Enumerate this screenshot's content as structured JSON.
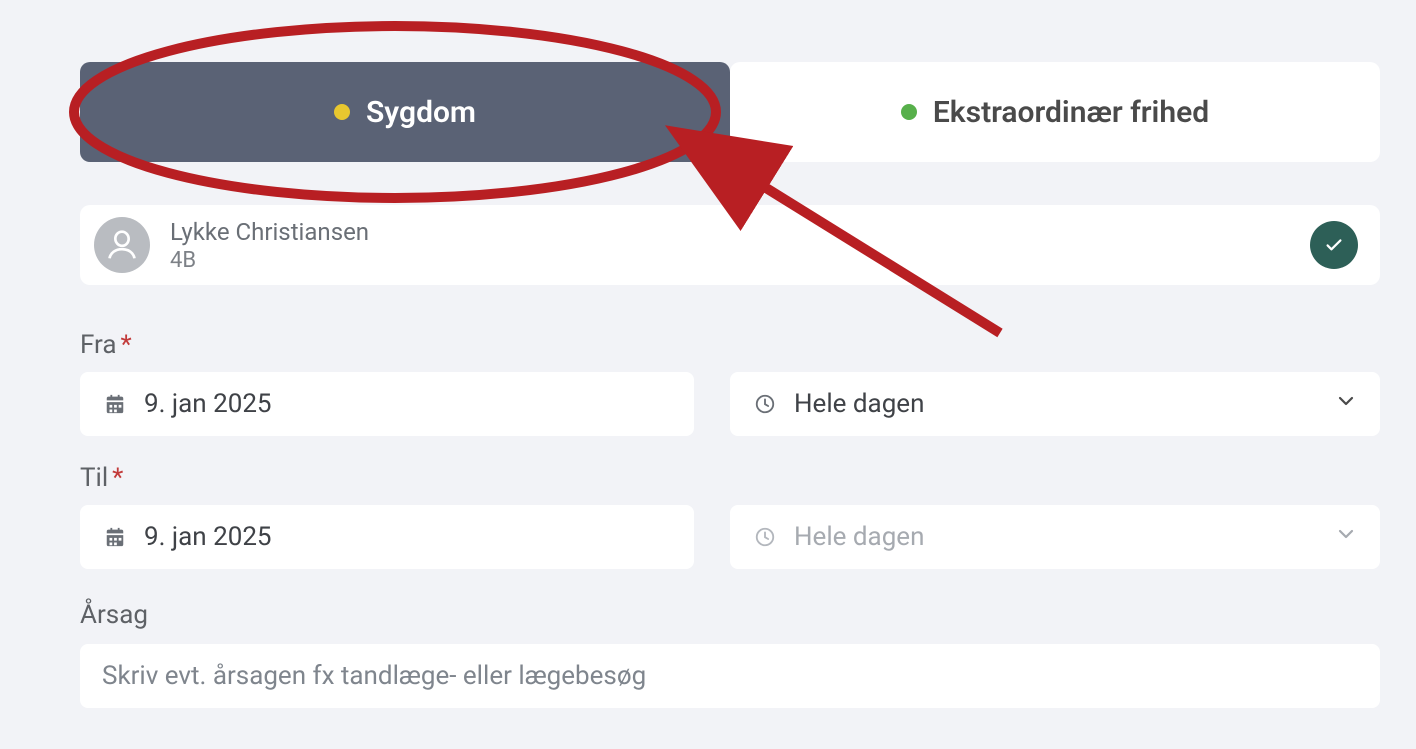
{
  "tabs": {
    "illness": {
      "label": "Sygdom",
      "dot_color": "#e8c72f",
      "active": true
    },
    "extra": {
      "label": "Ekstraordinær frihed",
      "dot_color": "#57b04b",
      "active": false
    }
  },
  "person": {
    "name": "Lykke Christiansen",
    "class": "4B",
    "selected": true
  },
  "labels": {
    "from": "Fra",
    "to": "Til",
    "reason": "Årsag",
    "required_mark": "*"
  },
  "from": {
    "date": "9. jan 2025",
    "time_label": "Hele dagen"
  },
  "to": {
    "date": "9. jan 2025",
    "time_label": "Hele dagen",
    "time_disabled": true
  },
  "reason": {
    "value": "",
    "placeholder": "Skriv evt. årsagen fx tandlæge- eller lægebesøg"
  },
  "annotation": {
    "ellipse_color": "#b81f23",
    "arrow_color": "#b81f23"
  }
}
